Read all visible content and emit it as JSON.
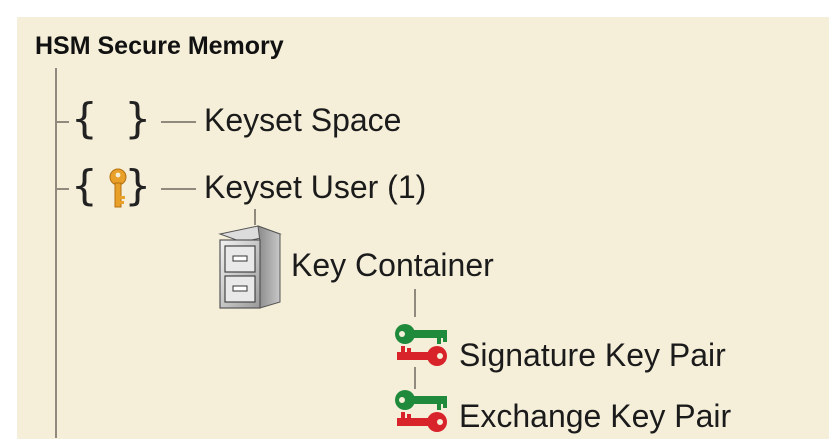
{
  "tree": {
    "root_label": "HSM Secure Memory",
    "nodes": [
      {
        "label": "Keyset Space",
        "icon": "empty-braces-icon"
      },
      {
        "label": "Keyset User (1)",
        "icon": "braces-key-icon"
      },
      {
        "label": "Key Container",
        "icon": "filing-cabinet-icon"
      },
      {
        "label": "Signature Key Pair",
        "icon": "key-pair-icon"
      },
      {
        "label": "Exchange Key Pair",
        "icon": "key-pair-icon"
      }
    ]
  },
  "colors": {
    "background": "#f5efd9",
    "connector": "#8f8a7d",
    "public_key": "#1f8a3c",
    "private_key": "#d8232a",
    "key_gold": "#e8a028"
  }
}
